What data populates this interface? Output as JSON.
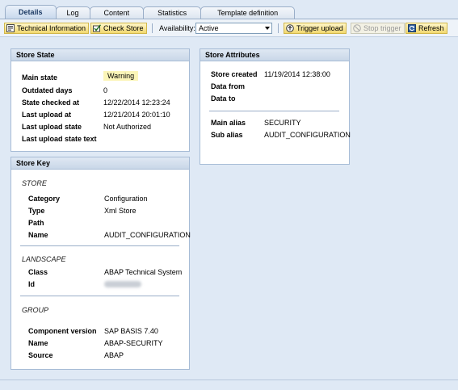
{
  "tabs": [
    {
      "label": "Details",
      "active": true
    },
    {
      "label": "Log"
    },
    {
      "label": "Content"
    },
    {
      "label": "Statistics"
    },
    {
      "label": "Template definition"
    }
  ],
  "toolbar": {
    "technical_information": "Technical Information",
    "check_store": "Check Store",
    "availability_label": "Availability:",
    "availability_value": "Active",
    "trigger_upload": "Trigger upload",
    "stop_trigger": "Stop trigger",
    "refresh": "Refresh"
  },
  "store_state": {
    "title": "Store State",
    "rows": [
      {
        "label": "Main state",
        "value": "Warning"
      },
      {
        "label": "Outdated days",
        "value": "0"
      },
      {
        "label": "State checked at",
        "value": "12/22/2014 12:23:24"
      },
      {
        "label": "Last upload at",
        "value": "12/21/2014 20:01:10"
      },
      {
        "label": "Last upload state",
        "value": "Not Authorized"
      },
      {
        "label": "Last upload state text",
        "value": ""
      }
    ]
  },
  "store_attributes": {
    "title": "Store Attributes",
    "rows": [
      {
        "label": "Store created",
        "value": "11/19/2014 12:38:00"
      },
      {
        "label": "Data from",
        "value": ""
      },
      {
        "label": "Data to",
        "value": ""
      },
      {
        "label": "Main alias",
        "value": "SECURITY"
      },
      {
        "label": "Sub alias",
        "value": "AUDIT_CONFIGURATION"
      }
    ]
  },
  "store_key": {
    "title": "Store Key",
    "store_section": "STORE",
    "store_rows": [
      {
        "label": "Category",
        "value": "Configuration"
      },
      {
        "label": "Type",
        "value": "Xml Store"
      },
      {
        "label": "Path",
        "value": ""
      },
      {
        "label": "Name",
        "value": "AUDIT_CONFIGURATION"
      }
    ],
    "landscape_section": "LANDSCAPE",
    "landscape_rows": [
      {
        "label": "Class",
        "value": "ABAP Technical System"
      },
      {
        "label": "Id",
        "value": ""
      }
    ],
    "group_section": "GROUP",
    "group_rows": [
      {
        "label": "Component version",
        "value": "SAP BASIS 7.40"
      },
      {
        "label": "Name",
        "value": "ABAP-SECURITY"
      },
      {
        "label": "Source",
        "value": "ABAP"
      }
    ]
  },
  "colors": {
    "warning_bg": "#fbf5b8",
    "button_bg": "#f1d86f",
    "panel_header": "#c9d7e8"
  }
}
